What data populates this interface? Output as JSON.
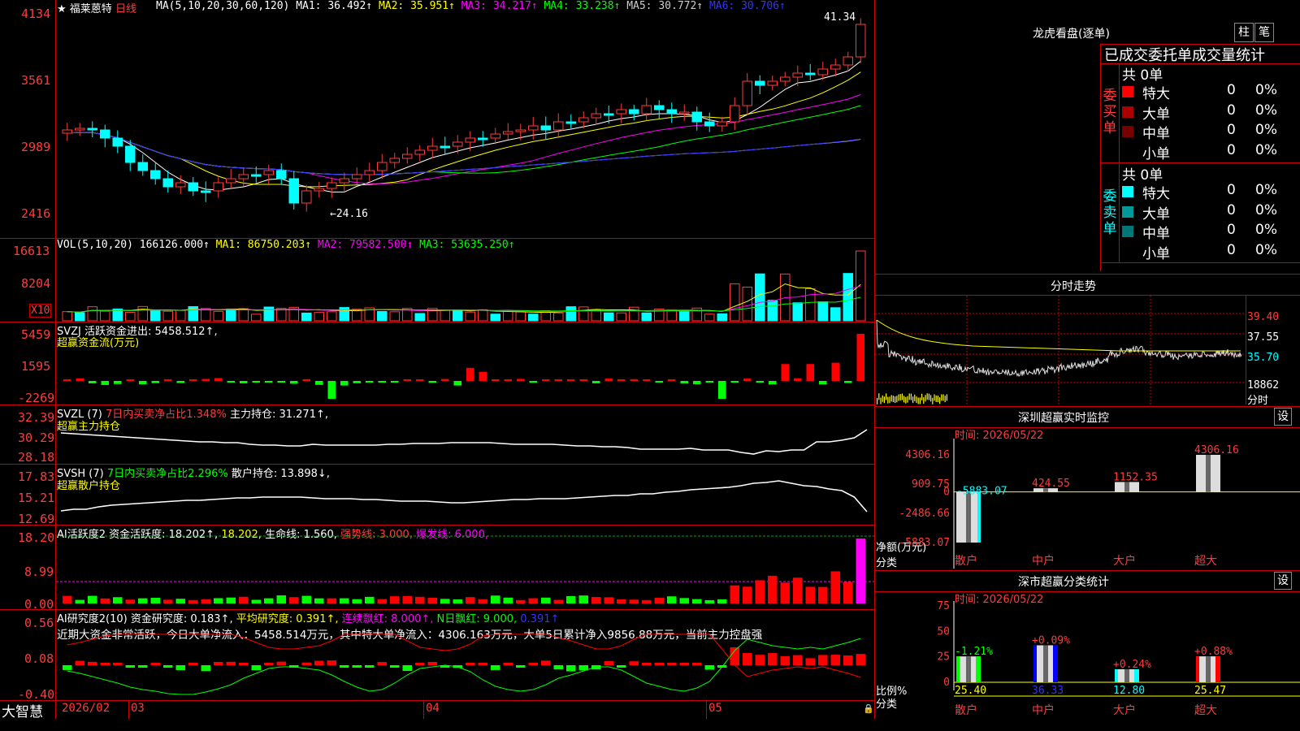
{
  "stock": {
    "star": "★",
    "name": "福莱蒽特",
    "period": "日线"
  },
  "price_axis": {
    "labels": [
      "4134",
      "3561",
      "2989",
      "2416"
    ]
  },
  "ma_header": {
    "prefix": "MA(5,10,20,30,60,120)",
    "items": [
      {
        "label": "MA1: 36.492↑",
        "color": "#ffffff"
      },
      {
        "label": "MA2: 35.951↑",
        "color": "#ffff00"
      },
      {
        "label": "MA3: 34.217↑",
        "color": "#ff00ff"
      },
      {
        "label": "MA4: 33.238↑",
        "color": "#00ff00"
      },
      {
        "label": "MA5: 30.772↑",
        "color": "#cccccc"
      },
      {
        "label": "MA6: 30.706↑",
        "color": "#3333ff"
      }
    ]
  },
  "price_annotations": {
    "high": "41.34",
    "low": "24.16"
  },
  "vol": {
    "axis": [
      "16613",
      "8204"
    ],
    "unit": "X10",
    "header": {
      "prefix": "VOL(5,10,20)",
      "value": "166126.000↑",
      "ma1": "MA1: 86750.203↑",
      "ma2": "MA2: 79582.500↑",
      "ma3": "MA3: 53635.250↑"
    }
  },
  "svzj": {
    "axis": [
      "5459",
      "1595",
      "-2269"
    ],
    "line1": "SVZJ  活跃资金进出: 5458.512↑,",
    "line2": "超赢资金流(万元)"
  },
  "svzl": {
    "axis": [
      "32.39",
      "30.29",
      "28.18"
    ],
    "prefix": "SVZL (7)",
    "pct": "7日内买卖净占比1.348%",
    "hold": "主力持仓: 31.271↑,",
    "line2": "超赢主力持仓"
  },
  "svsh": {
    "axis": [
      "17.83",
      "15.21",
      "12.69"
    ],
    "prefix": "SVSH (7)",
    "pct": "7日内买卖净占比2.296%",
    "hold": "散户持仓: 13.898↓,",
    "line2": "超赢散户持仓"
  },
  "ai_act": {
    "axis": [
      "18.20",
      "8.99",
      "0.00"
    ],
    "prefix": "AI活跃度2",
    "v1": "资金活跃度: 18.202↑,",
    "v2": "18.202,",
    "v3": "生命线: 1.560,",
    "v4": "强势线: 3.000,",
    "v5": "爆发线: 6.000,"
  },
  "ai_res": {
    "axis": [
      "0.56",
      "0.08",
      "-0.40"
    ],
    "prefix": "AI研究度2(10)",
    "v1": "资金研究度: 0.183↑,",
    "v2": "平均研究度: 0.391↑,",
    "v3": "连续飘红: 8.000↑,",
    "v4": "N日飘红: 9.000,",
    "v5": "0.391↑",
    "comment": "近期大资金非常活跃，今日大单净流入：5458.514万元，其中特大单净流入：4306.163万元，大单5日累计净入9856.88万元，当前主力控盘强"
  },
  "date_axis": {
    "brand": "大智慧",
    "labels": [
      "2026/02",
      "03",
      "04",
      "05"
    ]
  },
  "longhu": {
    "title": "龙虎看盘(逐单)",
    "tabs": [
      "柱",
      "笔"
    ],
    "heading": "已成交委托单成交量统计",
    "buy": {
      "side": "委买单",
      "total": "共 0单",
      "rows": [
        {
          "name": "特大",
          "count": "0",
          "pct": "0%",
          "color": "#ff0000"
        },
        {
          "name": "大单",
          "count": "0",
          "pct": "0%",
          "color": "#aa0000"
        },
        {
          "name": "中单",
          "count": "0",
          "pct": "0%",
          "color": "#770000"
        },
        {
          "name": "小单",
          "count": "0",
          "pct": "0%",
          "color": ""
        }
      ]
    },
    "sell": {
      "side": "委卖单",
      "total": "共 0单",
      "rows": [
        {
          "name": "特大",
          "count": "0",
          "pct": "0%",
          "color": "#00ffff"
        },
        {
          "name": "大单",
          "count": "0",
          "pct": "0%",
          "color": "#009999"
        },
        {
          "name": "中单",
          "count": "0",
          "pct": "0%",
          "color": "#007777"
        },
        {
          "name": "小单",
          "count": "0",
          "pct": "0%",
          "color": ""
        }
      ]
    }
  },
  "intraday": {
    "title": "分时走势",
    "axis": [
      "39.40",
      "37.55",
      "35.70",
      "18862"
    ],
    "unit": "分时"
  },
  "monitor": {
    "title": "深圳超赢实时监控",
    "time": "时间: 2026/05/22",
    "axis": [
      "4306.16",
      "909.75",
      "0",
      "-2486.66",
      "-5883.07"
    ],
    "ylabel": "净额(万元)",
    "xlabel": "分类",
    "bars": [
      {
        "cat": "散户",
        "value": -5883.07,
        "label": "-5883.07"
      },
      {
        "cat": "中户",
        "value": 424.55,
        "label": "424.55"
      },
      {
        "cat": "大户",
        "value": 1152.35,
        "label": "1152.35"
      },
      {
        "cat": "超大",
        "value": 4306.16,
        "label": "4306.16"
      }
    ],
    "settings_icon": "设"
  },
  "classify": {
    "title": "深市超赢分类统计",
    "time": "时间: 2026/05/22",
    "axis": [
      "75",
      "50",
      "25",
      "0"
    ],
    "ylabel": "比例%",
    "xlabel": "分类",
    "bars": [
      {
        "cat": "散户",
        "value": 25.4,
        "label": "25.40",
        "chg": "-1.21%"
      },
      {
        "cat": "中户",
        "value": 36.33,
        "label": "36.33",
        "chg": "+0.09%"
      },
      {
        "cat": "大户",
        "value": 12.8,
        "label": "12.80",
        "chg": "+0.24%"
      },
      {
        "cat": "超大",
        "value": 25.47,
        "label": "25.47",
        "chg": "+0.88%"
      }
    ],
    "settings_icon": "设"
  },
  "chart_data": [
    {
      "type": "bar",
      "title": "深圳超赢实时监控",
      "ylabel": "净额(万元)",
      "categories": [
        "散户",
        "中户",
        "大户",
        "超大"
      ],
      "values": [
        -5883.07,
        424.55,
        1152.35,
        4306.16
      ],
      "ylim": [
        -5883.07,
        4306.16
      ]
    },
    {
      "type": "bar",
      "title": "深市超赢分类统计",
      "ylabel": "比例%",
      "categories": [
        "散户",
        "中户",
        "大户",
        "超大"
      ],
      "values": [
        25.4,
        36.33,
        12.8,
        25.47
      ],
      "ylim": [
        0,
        75
      ]
    }
  ]
}
